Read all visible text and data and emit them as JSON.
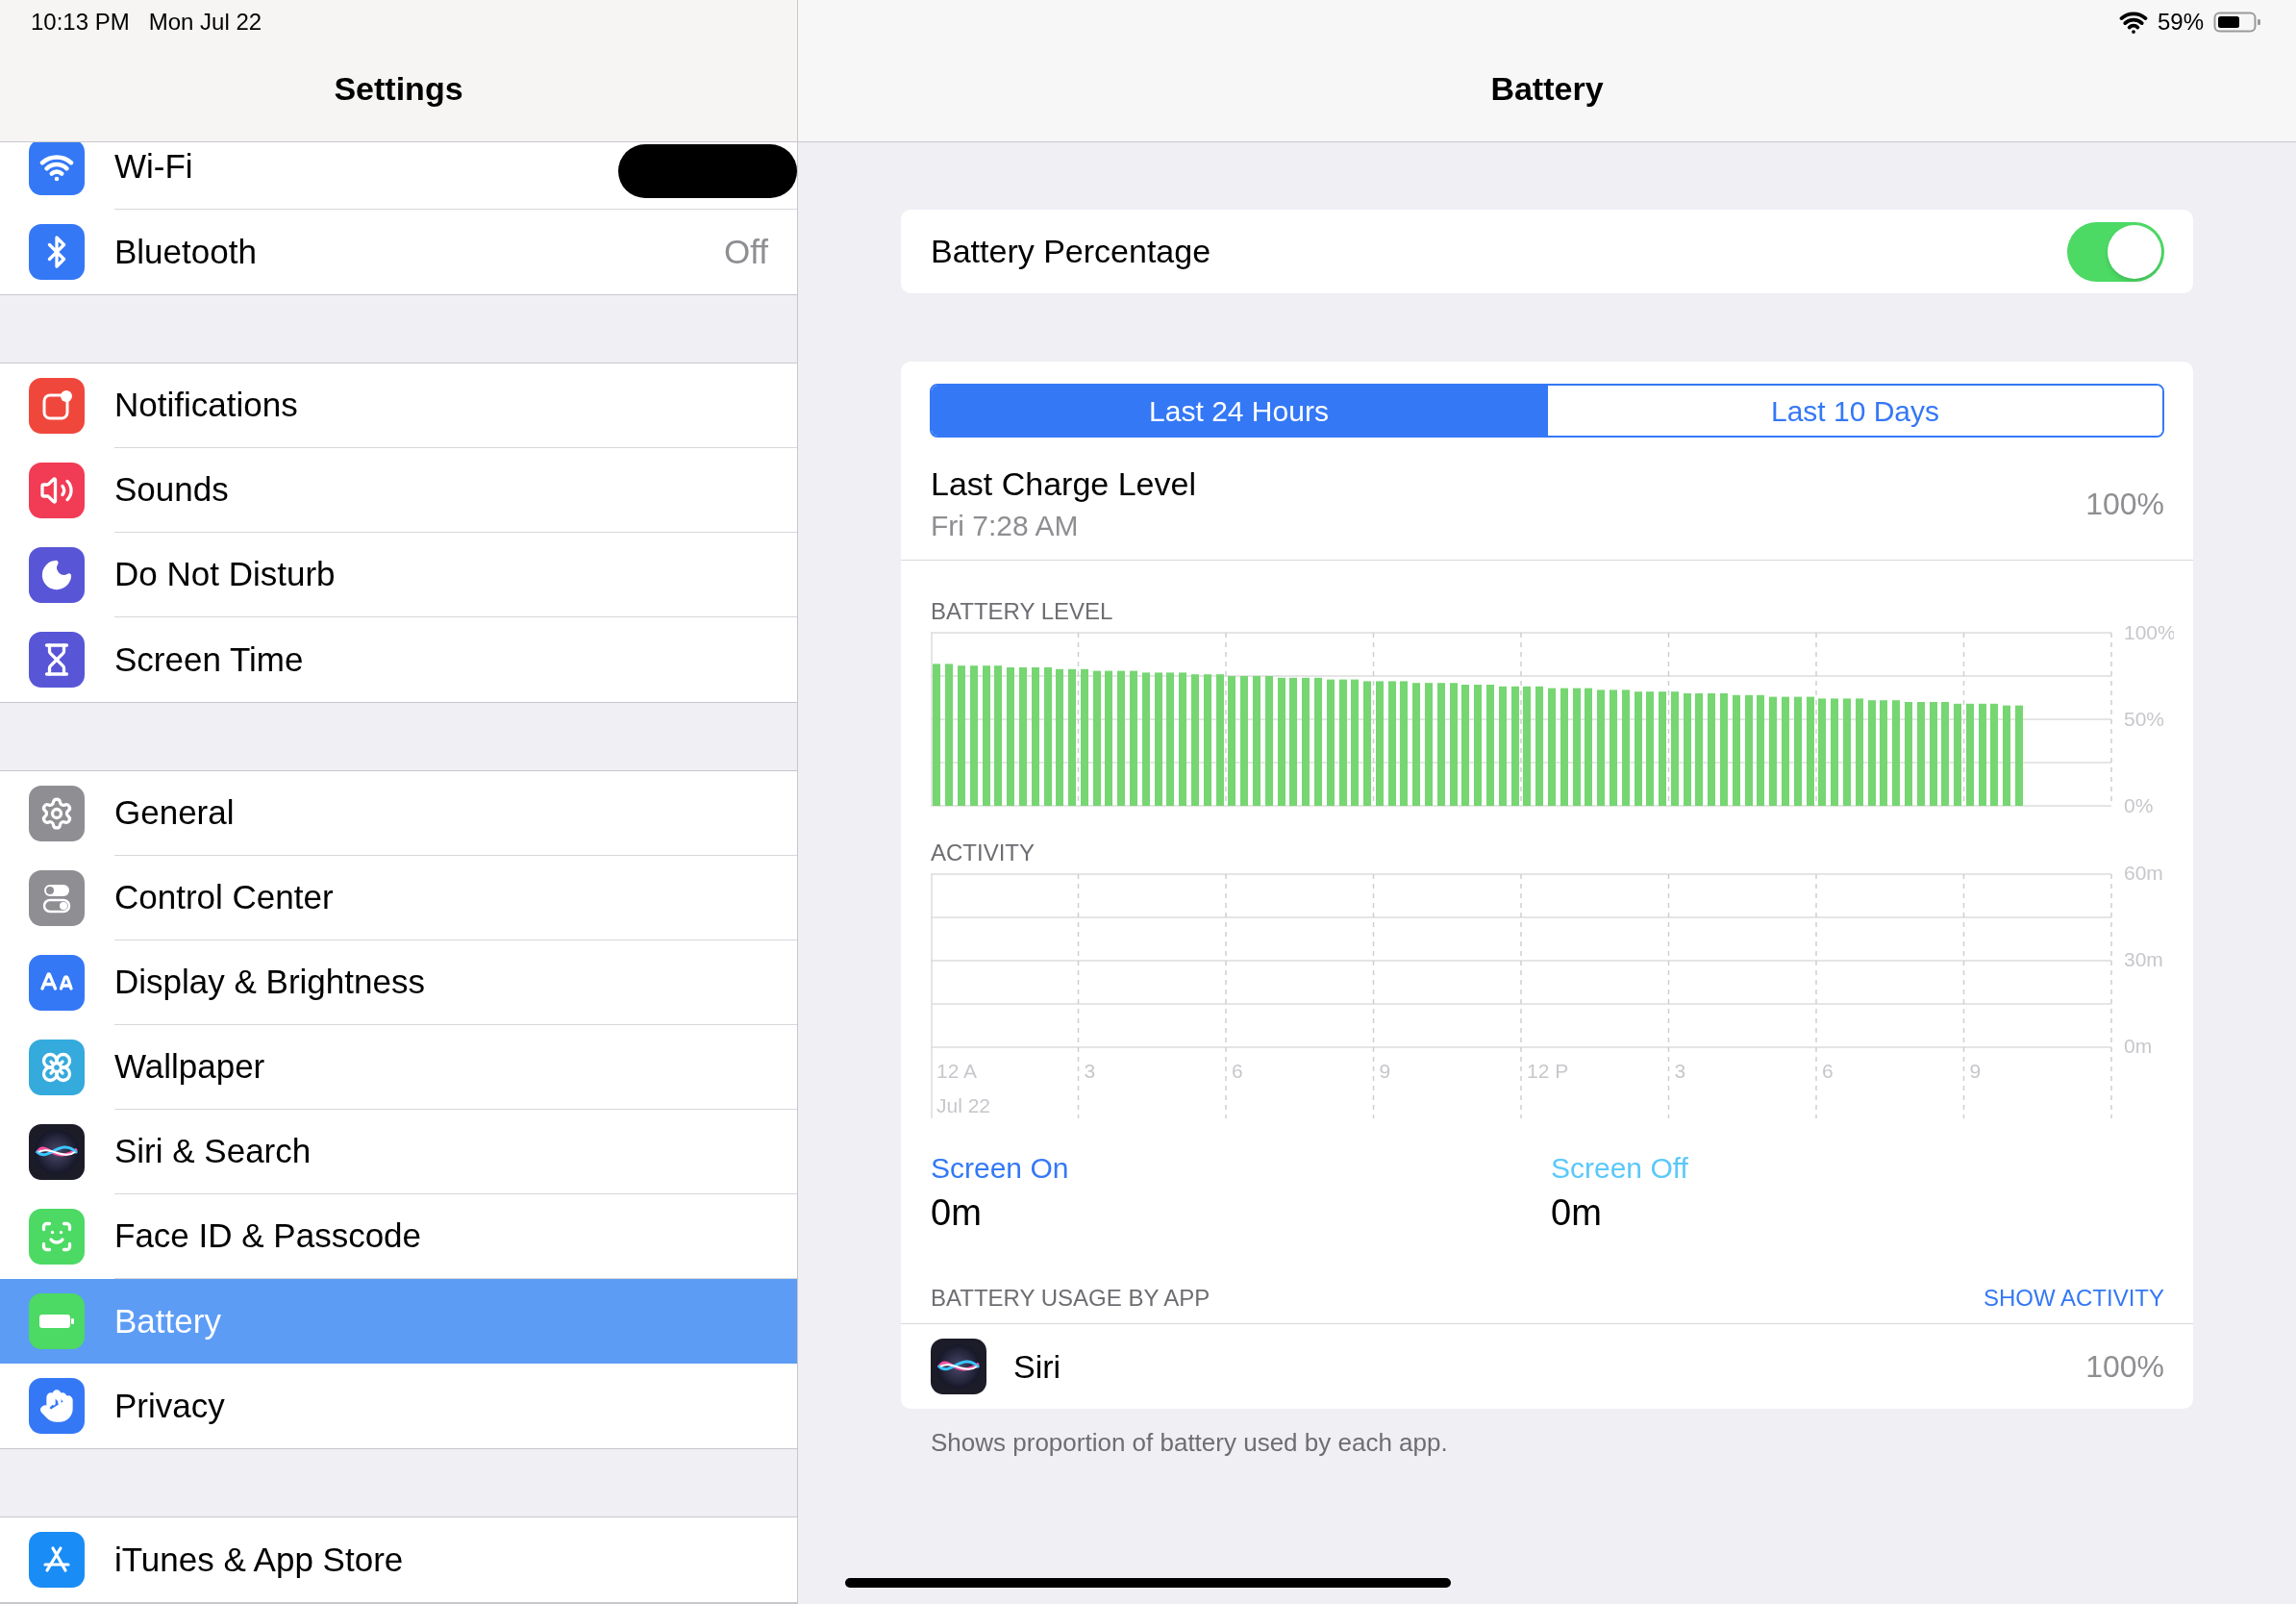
{
  "status_bar": {
    "time": "10:13 PM",
    "date": "Mon Jul 22",
    "battery_percent": "59%"
  },
  "sidebar": {
    "title": "Settings",
    "groups": [
      {
        "items": [
          {
            "label": "Wi-Fi",
            "selected": false
          },
          {
            "label": "Bluetooth",
            "value": "Off",
            "selected": false
          }
        ]
      },
      {
        "items": [
          {
            "label": "Notifications",
            "selected": false
          },
          {
            "label": "Sounds",
            "selected": false
          },
          {
            "label": "Do Not Disturb",
            "selected": false
          },
          {
            "label": "Screen Time",
            "selected": false
          }
        ]
      },
      {
        "items": [
          {
            "label": "General",
            "selected": false
          },
          {
            "label": "Control Center",
            "selected": false
          },
          {
            "label": "Display & Brightness",
            "selected": false
          },
          {
            "label": "Wallpaper",
            "selected": false
          },
          {
            "label": "Siri & Search",
            "selected": false
          },
          {
            "label": "Face ID & Passcode",
            "selected": false
          },
          {
            "label": "Battery",
            "selected": true
          },
          {
            "label": "Privacy",
            "selected": false
          }
        ]
      },
      {
        "items": [
          {
            "label": "iTunes & App Store",
            "selected": false
          }
        ]
      }
    ]
  },
  "detail": {
    "title": "Battery",
    "battery_percentage": {
      "label": "Battery Percentage",
      "on": true
    },
    "tabs": [
      {
        "label": "Last 24 Hours",
        "selected": true
      },
      {
        "label": "Last 10 Days",
        "selected": false
      }
    ],
    "last_charge": {
      "label": "Last Charge Level",
      "time": "Fri 7:28 AM",
      "value": "100%"
    },
    "battery_level": {
      "label": "BATTERY LEVEL",
      "chart_data": {
        "type": "bar",
        "grid": true,
        "ylim": [
          0,
          100
        ],
        "categories": [
          null,
          null,
          null,
          null,
          null,
          null,
          null,
          null,
          null,
          null,
          null,
          null,
          null,
          null,
          null,
          null,
          null,
          null,
          null,
          null,
          null,
          null,
          null,
          null,
          null,
          null,
          null,
          null,
          null,
          null,
          null,
          null,
          null,
          null,
          null,
          null,
          null,
          null,
          null,
          null,
          null,
          null,
          null,
          null,
          null,
          null,
          null,
          null,
          null,
          null,
          null,
          null,
          null,
          null,
          null,
          null,
          null,
          null,
          null,
          null,
          null,
          null,
          null,
          null,
          null,
          null,
          null,
          null,
          null,
          null,
          null,
          null,
          null,
          null,
          null,
          null,
          null,
          null,
          null,
          null,
          null,
          null,
          null,
          null,
          null,
          null,
          null,
          null,
          null,
          null,
          null,
          null,
          null,
          null,
          null,
          null
        ],
        "yticks": [
          {
            "value": 0,
            "label": "0%"
          },
          {
            "value": 50,
            "label": "50%"
          },
          {
            "value": 100,
            "label": "100%"
          }
        ],
        "values": [
          82,
          82,
          81,
          81,
          81,
          81,
          80,
          80,
          80,
          80,
          79,
          79,
          79,
          78,
          78,
          78,
          78,
          77,
          77,
          77,
          77,
          76,
          76,
          76,
          75,
          75,
          75,
          75,
          74,
          74,
          74,
          74,
          73,
          73,
          73,
          72,
          72,
          72,
          72,
          71,
          71,
          71,
          71,
          70,
          70,
          70,
          69,
          69,
          69,
          69,
          68,
          68,
          68,
          68,
          67,
          67,
          67,
          66,
          66,
          66,
          66,
          65,
          65,
          65,
          65,
          64,
          64,
          64,
          63,
          63,
          63,
          63,
          62,
          62,
          62,
          62,
          61,
          61,
          61,
          60,
          60,
          60,
          60,
          59,
          59,
          59,
          59,
          58,
          58,
          null,
          null,
          null,
          null,
          null,
          null,
          null
        ]
      }
    },
    "activity": {
      "label": "ACTIVITY",
      "date": "Jul 22",
      "chart_data": {
        "type": "bar",
        "grid": true,
        "ylim": [
          0,
          60
        ],
        "yticks": [
          {
            "value": 0,
            "label": "0m"
          },
          {
            "value": 30,
            "label": "30m"
          },
          {
            "value": 60,
            "label": "60m"
          }
        ],
        "categories": [
          "12 A",
          "3",
          "6",
          "9",
          "12 P",
          "3",
          "6",
          "9"
        ]
      }
    },
    "legend": [
      {
        "label": "Screen On",
        "value": "0m",
        "color": "#3478f6"
      },
      {
        "label": "Screen Off",
        "value": "0m",
        "color": "#5ac8fa"
      }
    ],
    "usage": {
      "label": "BATTERY USAGE BY APP",
      "action": "SHOW ACTIVITY",
      "apps": [
        {
          "name": "Siri",
          "value": "100%"
        }
      ]
    },
    "footer": "Shows proportion of battery used by each app."
  }
}
